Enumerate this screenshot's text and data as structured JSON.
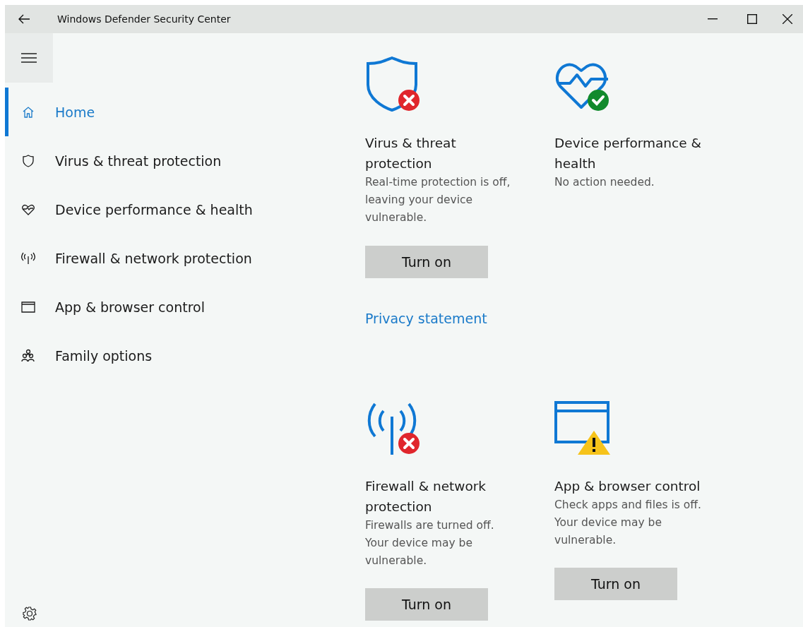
{
  "window": {
    "title": "Windows Defender Security Center"
  },
  "sidebar": {
    "items": [
      {
        "label": "Home",
        "kind": "home",
        "selected": true
      },
      {
        "label": "Virus & threat protection",
        "kind": "virus",
        "selected": false
      },
      {
        "label": "Device performance & health",
        "kind": "health",
        "selected": false
      },
      {
        "label": "Firewall & network protection",
        "kind": "firewall",
        "selected": false
      },
      {
        "label": "App & browser control",
        "kind": "app",
        "selected": false
      },
      {
        "label": "Family options",
        "kind": "family",
        "selected": false
      }
    ]
  },
  "cards_top": [
    {
      "kind": "virus",
      "title": "Virus & threat protection",
      "description": "Real-time protection is off, leaving your device vulnerable.",
      "button": "Turn on"
    },
    {
      "kind": "health",
      "title": "Device performance & health",
      "description": "No action needed."
    }
  ],
  "privacy_link": "Privacy statement",
  "cards_bottom": [
    {
      "kind": "firewall",
      "title": "Firewall & network protection",
      "description": "Firewalls are turned off. Your device may be vulnerable.",
      "button": "Turn on"
    },
    {
      "kind": "app",
      "title": "App & browser control",
      "description": "Check apps and files is off. Your device may be vulnerable.",
      "button": "Turn on"
    }
  ]
}
